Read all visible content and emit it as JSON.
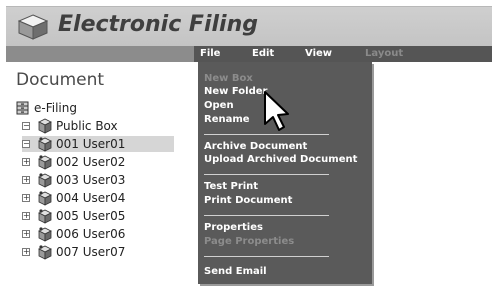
{
  "app": {
    "title": "Electronic Filing",
    "logo_icon": "cube-box-icon"
  },
  "menubar": {
    "items": [
      {
        "label": "File",
        "enabled": true
      },
      {
        "label": "Edit",
        "enabled": true
      },
      {
        "label": "View",
        "enabled": true
      },
      {
        "label": "Layout",
        "enabled": false
      }
    ]
  },
  "panel": {
    "title": "Document",
    "root": {
      "label": "e-Filing",
      "icon": "cabinet-icon"
    },
    "nodes": [
      {
        "label": "Public Box",
        "expander": "minus",
        "icon": "public-box-icon",
        "selected": false
      },
      {
        "label": "001 User01",
        "expander": "minus",
        "icon": "user-box-icon",
        "selected": true
      },
      {
        "label": "002 User02",
        "expander": "plus",
        "icon": "user-box-icon",
        "selected": false
      },
      {
        "label": "003 User03",
        "expander": "plus",
        "icon": "user-box-icon",
        "selected": false
      },
      {
        "label": "004 User04",
        "expander": "plus",
        "icon": "user-box-icon",
        "selected": false
      },
      {
        "label": "005 User05",
        "expander": "plus",
        "icon": "user-box-icon",
        "selected": false
      },
      {
        "label": "006 User06",
        "expander": "plus",
        "icon": "user-box-icon",
        "selected": false
      },
      {
        "label": "007 User07",
        "expander": "plus",
        "icon": "user-box-icon",
        "selected": false
      }
    ]
  },
  "file_menu": {
    "groups": [
      [
        {
          "label": "New Box",
          "enabled": false
        },
        {
          "label": "New Folder",
          "enabled": true
        },
        {
          "label": "Open",
          "enabled": true
        },
        {
          "label": "Rename",
          "enabled": true
        }
      ],
      [
        {
          "label": "Archive Document",
          "enabled": true
        },
        {
          "label": "Upload Archived Document",
          "enabled": true
        }
      ],
      [
        {
          "label": "Test Print",
          "enabled": true
        },
        {
          "label": "Print Document",
          "enabled": true
        }
      ],
      [
        {
          "label": "Properties",
          "enabled": true
        },
        {
          "label": "Page Properties",
          "enabled": false
        }
      ],
      [
        {
          "label": "Send Email",
          "enabled": true
        }
      ]
    ]
  },
  "cursor_icon": "arrow-cursor-icon"
}
